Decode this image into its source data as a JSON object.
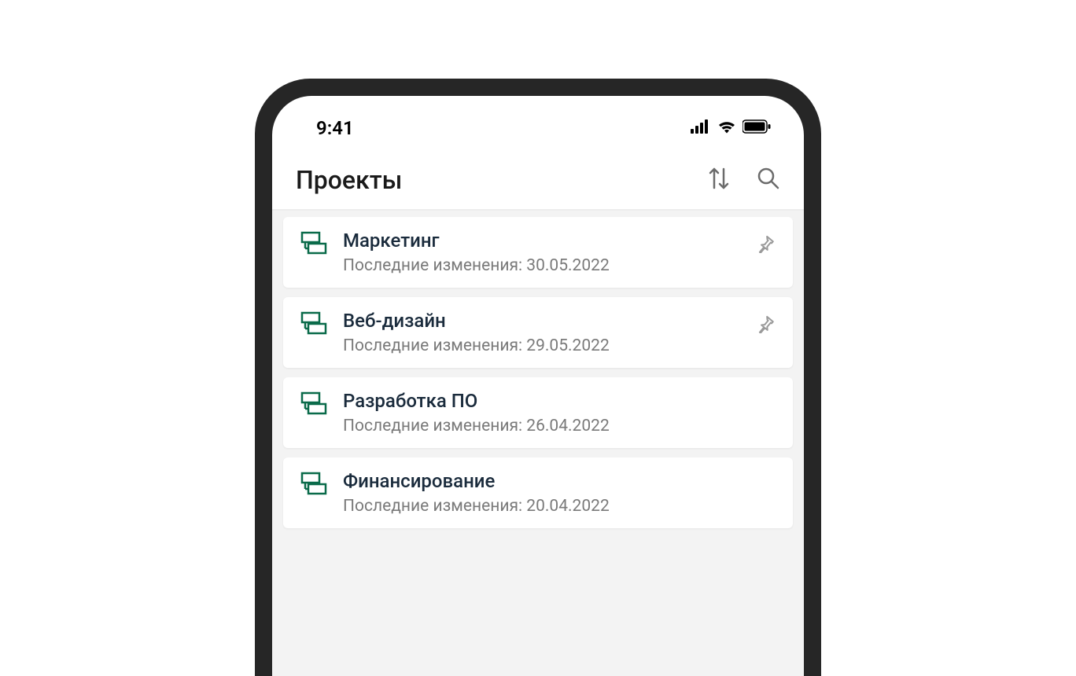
{
  "status_bar": {
    "time": "9:41"
  },
  "header": {
    "title": "Проекты"
  },
  "projects": [
    {
      "title": "Маркетинг",
      "subtitle": "Последние изменения: 30.05.2022",
      "pinned": true
    },
    {
      "title": "Веб-дизайн",
      "subtitle": "Последние изменения: 29.05.2022",
      "pinned": true
    },
    {
      "title": "Разработка ПО",
      "subtitle": "Последние изменения: 26.04.2022",
      "pinned": false
    },
    {
      "title": "Финансирование",
      "subtitle": "Последние изменения: 20.04.2022",
      "pinned": false
    }
  ]
}
